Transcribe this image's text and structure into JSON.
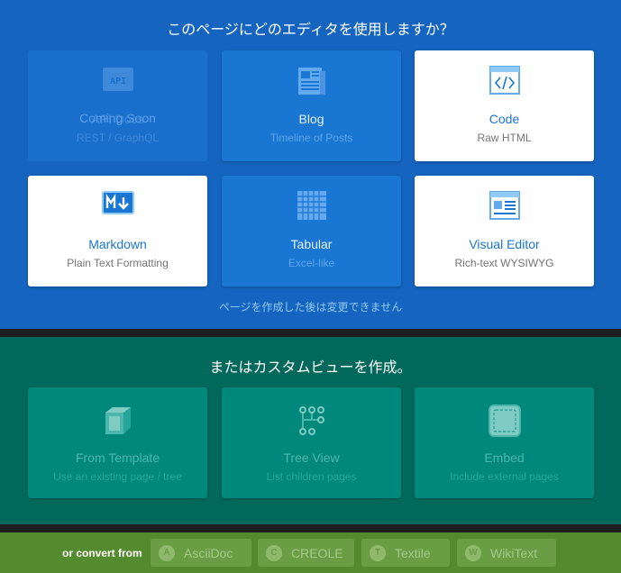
{
  "editor_section": {
    "title": "このページにどのエディタを使用しますか？",
    "note": "ページを作成した後は変更できません",
    "cards": [
      {
        "name": "API Docs",
        "subtitle": "REST / GraphQL",
        "icon": "api-icon",
        "overlay": "Coming Soon"
      },
      {
        "name": "Blog",
        "subtitle": "Timeline of Posts",
        "icon": "newspaper-icon"
      },
      {
        "name": "Code",
        "subtitle": "Raw HTML",
        "icon": "code-window-icon"
      },
      {
        "name": "Markdown",
        "subtitle": "Plain Text Formatting",
        "icon": "markdown-icon"
      },
      {
        "name": "Tabular",
        "subtitle": "Excel-like",
        "icon": "grid-table-icon"
      },
      {
        "name": "Visual Editor",
        "subtitle": "Rich-text WYSIWYG",
        "icon": "wysiwyg-window-icon"
      }
    ]
  },
  "custom_section": {
    "title": "またはカスタムビューを作成。",
    "cards": [
      {
        "name": "From Template",
        "subtitle": "Use an existing page / tree",
        "icon": "cube-icon"
      },
      {
        "name": "Tree View",
        "subtitle": "List children pages",
        "icon": "tree-icon"
      },
      {
        "name": "Embed",
        "subtitle": "Include external pages",
        "icon": "embed-icon"
      }
    ]
  },
  "convert_section": {
    "label": "or convert from",
    "options": [
      {
        "letter": "A",
        "label": "AsciiDoc"
      },
      {
        "letter": "C",
        "label": "CREOLE"
      },
      {
        "letter": "T",
        "label": "Textile"
      },
      {
        "letter": "W",
        "label": "WikiText"
      }
    ]
  },
  "colors": {
    "editor_bg": "#1565c0",
    "custom_bg": "#00695c",
    "convert_bg": "#558b2f",
    "accent": "#1976d2"
  }
}
